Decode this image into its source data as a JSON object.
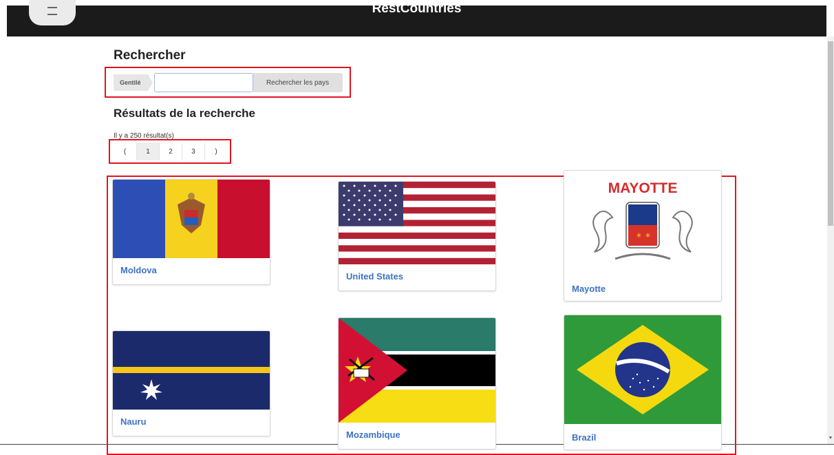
{
  "header": {
    "title": "RestCountries",
    "menu_icon": "hamburger-icon"
  },
  "search": {
    "heading": "Rechercher",
    "tag_label": "Gentilé",
    "input_value": "",
    "button_label": "Rechercher les pays"
  },
  "results": {
    "heading": "Résultats de la recherche",
    "count_text": "Il y a 250 résultat(s)",
    "pagination": [
      "(",
      "1",
      "2",
      "3",
      ")"
    ],
    "active_page": "1"
  },
  "countries": [
    {
      "name": "Moldova"
    },
    {
      "name": "United States"
    },
    {
      "name": "Mayotte",
      "flag_text": "MAYOTTE"
    },
    {
      "name": "Nauru"
    },
    {
      "name": "Mozambique"
    },
    {
      "name": "Brazil"
    }
  ],
  "colors": {
    "accent_link": "#3d72c3",
    "highlight_box": "#e0151e",
    "topbar": "#1b1b1b"
  }
}
